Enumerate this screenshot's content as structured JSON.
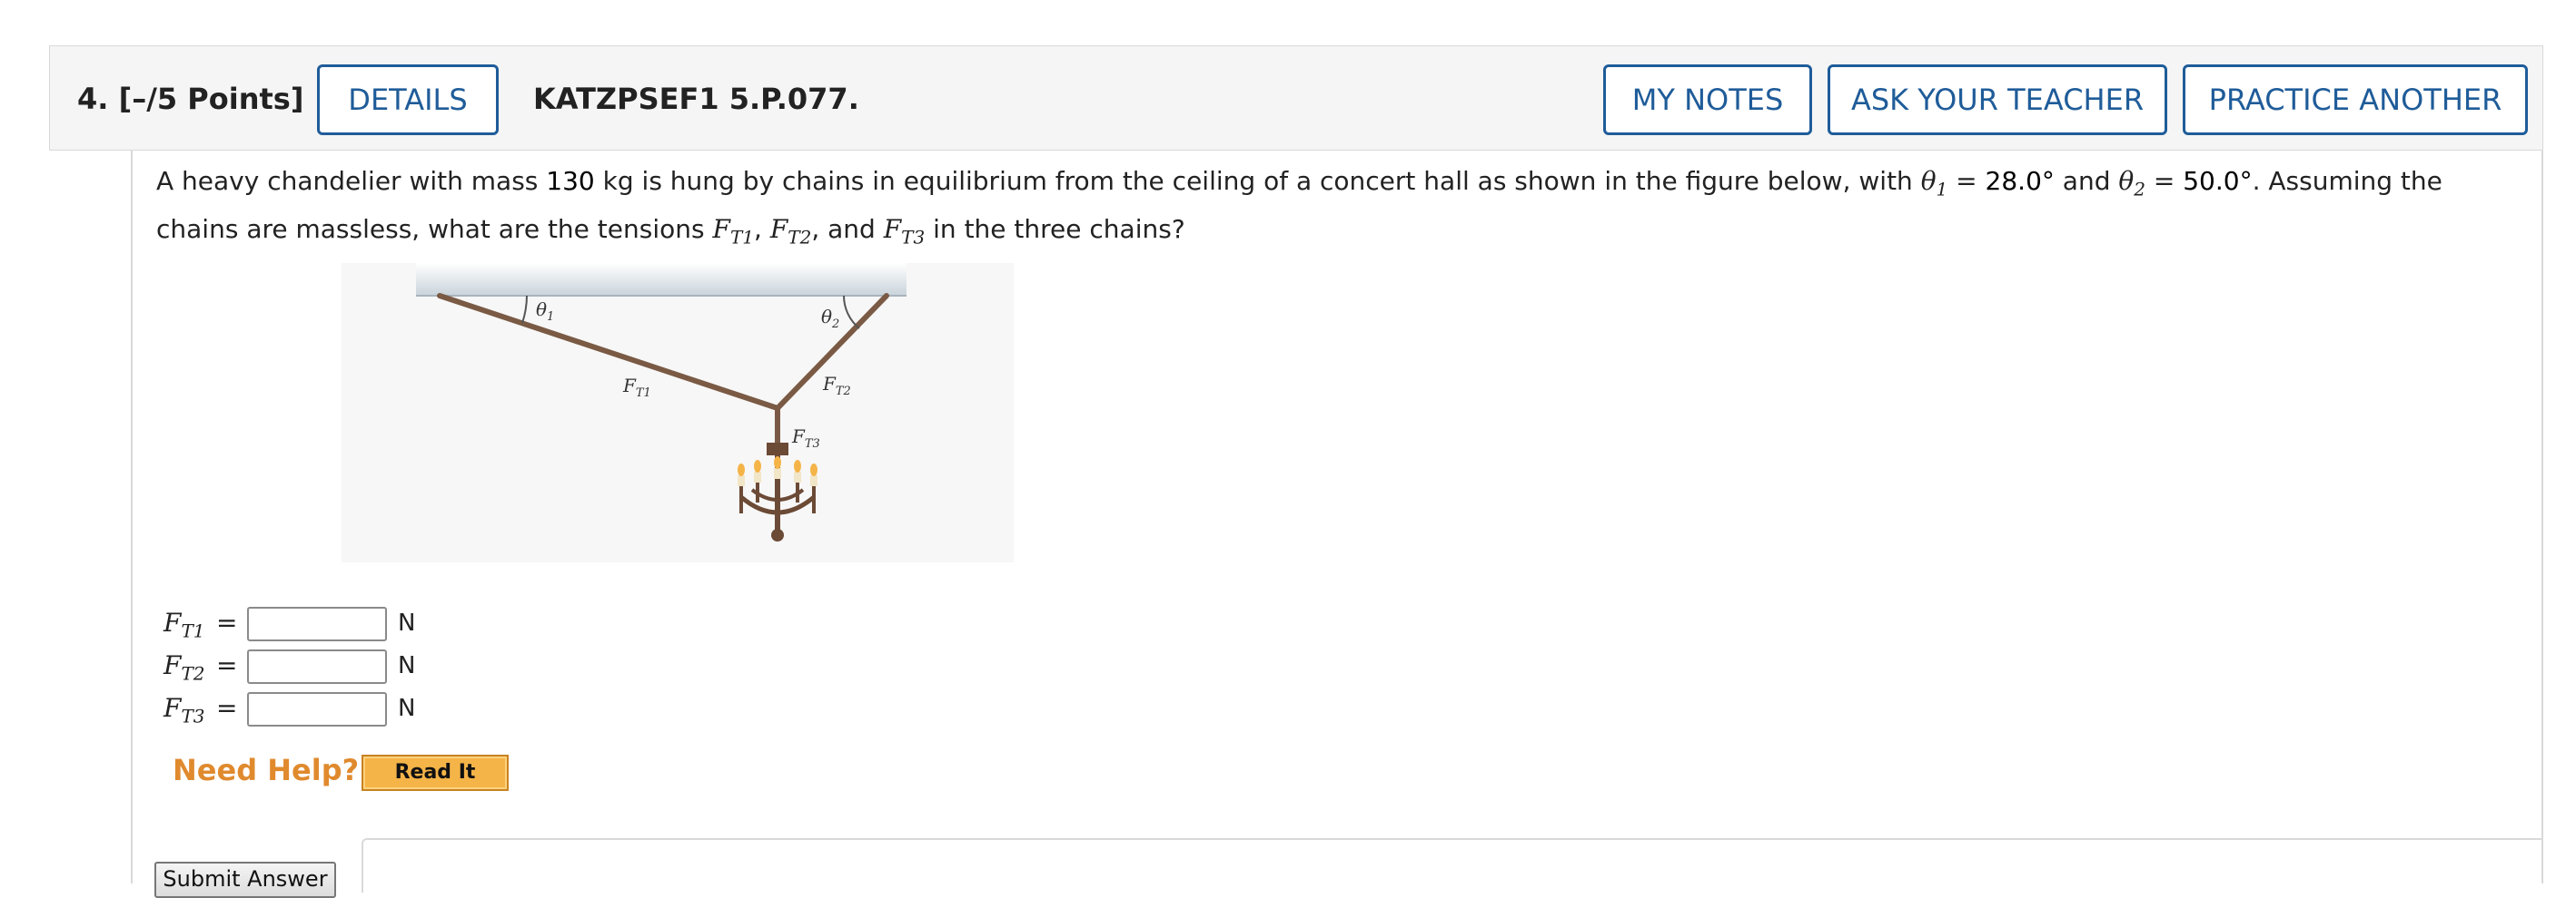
{
  "header": {
    "question_number": "4.",
    "points": "[–/5 Points]",
    "details_label": "DETAILS",
    "code": "KATZPSEF1 5.P.077.",
    "my_notes_label": "MY NOTES",
    "ask_teacher_label": "ASK YOUR TEACHER",
    "practice_another_label": "PRACTICE ANOTHER"
  },
  "question": {
    "text_1": "A heavy chandelier with mass ",
    "mass_value": "130",
    "text_2": " kg is hung by chains in equilibrium from the ceiling of a concert hall as shown in the figure below, with ",
    "theta": "θ",
    "theta1_sub": "1",
    "eq1": " = ",
    "theta1_value": "28.0°",
    "and_1": " and ",
    "theta2_sub": "2",
    "eq2": " = ",
    "theta2_value": "50.0°",
    "text_3": ". Assuming the chains are massless, what are the tensions ",
    "F": "F",
    "T1": "T1",
    "T2": "T2",
    "T3": "T3",
    "comma": ", ",
    "and_2": ", and ",
    "text_4": " in the three chains?"
  },
  "figure": {
    "theta1_label": "θ",
    "theta1_sub": "1",
    "theta2_label": "θ",
    "theta2_sub": "2",
    "ft1_label": "F",
    "ft1_sub": "T1",
    "ft2_label": "F",
    "ft2_sub": "T2",
    "ft3_label": "F",
    "ft3_sub": "T3",
    "chain_color": "#7a5a44",
    "ceiling_color": "#d6dde2"
  },
  "answers": [
    {
      "symbol": "F",
      "sub": "T1",
      "equals": "=",
      "value": "",
      "unit": "N"
    },
    {
      "symbol": "F",
      "sub": "T2",
      "equals": "=",
      "value": "",
      "unit": "N"
    },
    {
      "symbol": "F",
      "sub": "T3",
      "equals": "=",
      "value": "",
      "unit": "N"
    }
  ],
  "help": {
    "need_help_label": "Need Help?",
    "read_it_label": "Read It"
  },
  "submit_label": "Submit Answer",
  "colors": {
    "accent": "#1f5c99",
    "help_orange": "#e08a2e",
    "readit_bg": "#f5b448"
  }
}
